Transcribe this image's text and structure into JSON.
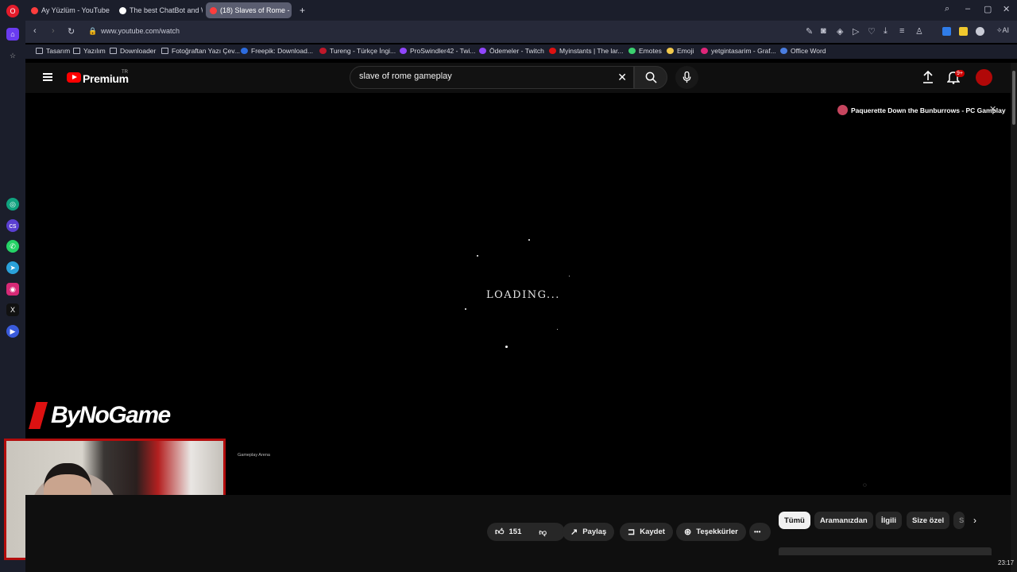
{
  "browser": {
    "tabs": [
      {
        "label": "Ay Yüzlüm - YouTube",
        "color": "#ff3d3d"
      },
      {
        "label": "The best ChatBot and Wid",
        "color": "#ffffff"
      },
      {
        "label": "(18) Slaves of Rome -",
        "color": "#ff3d3d"
      }
    ],
    "new_tab": "+",
    "url": "www.youtube.com/watch",
    "bookmarks": [
      {
        "label": "Tasarım",
        "color": ""
      },
      {
        "label": "Yazılım",
        "color": ""
      },
      {
        "label": "Downloader",
        "color": ""
      },
      {
        "label": "Fotoğraftan Yazı Çev...",
        "color": ""
      },
      {
        "label": "Freepik: Download...",
        "color": "#2d6cdf"
      },
      {
        "label": "Tureng - Türkçe İngi...",
        "color": "#c0182a"
      },
      {
        "label": "ProSwindler42 - Twi...",
        "color": "#9146ff"
      },
      {
        "label": "Ödemeler - Twitch",
        "color": "#9146ff"
      },
      {
        "label": "Myinstants | The lar...",
        "color": "#d11"
      },
      {
        "label": "Emotes",
        "color": "#3bd16f"
      },
      {
        "label": "Emoji",
        "color": "#f2c94c"
      },
      {
        "label": "yetgintasarim - Graf...",
        "color": "#e0267a"
      },
      {
        "label": "Office Word",
        "color": "#4a7de0"
      }
    ]
  },
  "youtube": {
    "logo_text": "Premium",
    "region": "TR",
    "search_value": "slave of rome gameplay",
    "notification_badge": "9+"
  },
  "player": {
    "loading_text": "LOADING...",
    "up_next_title": "Paquerette Down the Bunburrows - PC Gamplay",
    "channel_watermark": "Gameplay Arena",
    "overlay_brand": "ByNoGame"
  },
  "actions": {
    "like_count": "151",
    "share": "Paylaş",
    "save": "Kaydet",
    "thanks": "Teşekkürler",
    "more": "•••"
  },
  "chips": [
    {
      "label": "Tümü",
      "selected": true
    },
    {
      "label": "Aramanızdan",
      "selected": false
    },
    {
      "label": "İlgili",
      "selected": false
    },
    {
      "label": "Size özel",
      "selected": false
    },
    {
      "label": "S",
      "selected": false
    }
  ],
  "taskbar": {
    "clock": "23:17"
  }
}
